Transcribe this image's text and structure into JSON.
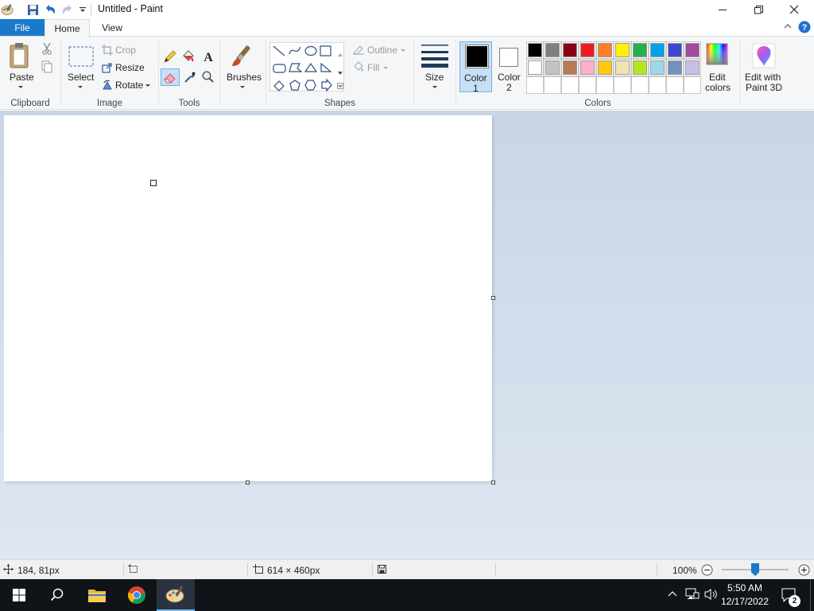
{
  "window": {
    "title": "Untitled - Paint"
  },
  "tabs": {
    "file": "File",
    "home": "Home",
    "view": "View"
  },
  "ribbon": {
    "clipboard": {
      "label": "Clipboard",
      "paste": "Paste"
    },
    "image": {
      "label": "Image",
      "select": "Select",
      "crop": "Crop",
      "resize": "Resize",
      "rotate": "Rotate"
    },
    "tools": {
      "label": "Tools"
    },
    "brushes": {
      "label": "Brushes"
    },
    "shapes": {
      "label": "Shapes",
      "outline": "Outline",
      "fill": "Fill"
    },
    "size": {
      "label": "Size"
    },
    "colors": {
      "label": "Colors",
      "color1": "Color",
      "color1_num": "1",
      "color2": "Color",
      "color2_num": "2",
      "color1_value": "#000000",
      "color2_value": "#ffffff",
      "edit_colors": "Edit",
      "edit_colors_2": "colors",
      "palette_row1": [
        "#000000",
        "#7f7f7f",
        "#880015",
        "#ed1c24",
        "#ff7f27",
        "#fff200",
        "#22b14c",
        "#00a2e8",
        "#3f48cc",
        "#a349a4"
      ],
      "palette_row2": [
        "#ffffff",
        "#c3c3c3",
        "#b97a57",
        "#ffaec9",
        "#ffc90e",
        "#efe4b0",
        "#b5e61d",
        "#99d9ea",
        "#7092be",
        "#c8bfe7"
      ]
    },
    "paint3d": {
      "label1": "Edit with",
      "label2": "Paint 3D"
    }
  },
  "status": {
    "cursor_pos": "184, 81px",
    "image_size": "614 × 460px",
    "zoom": "100%",
    "zoom_level": 0.5
  },
  "taskbar": {
    "time": "5:50 AM",
    "date": "12/17/2022",
    "notifications": "2"
  }
}
